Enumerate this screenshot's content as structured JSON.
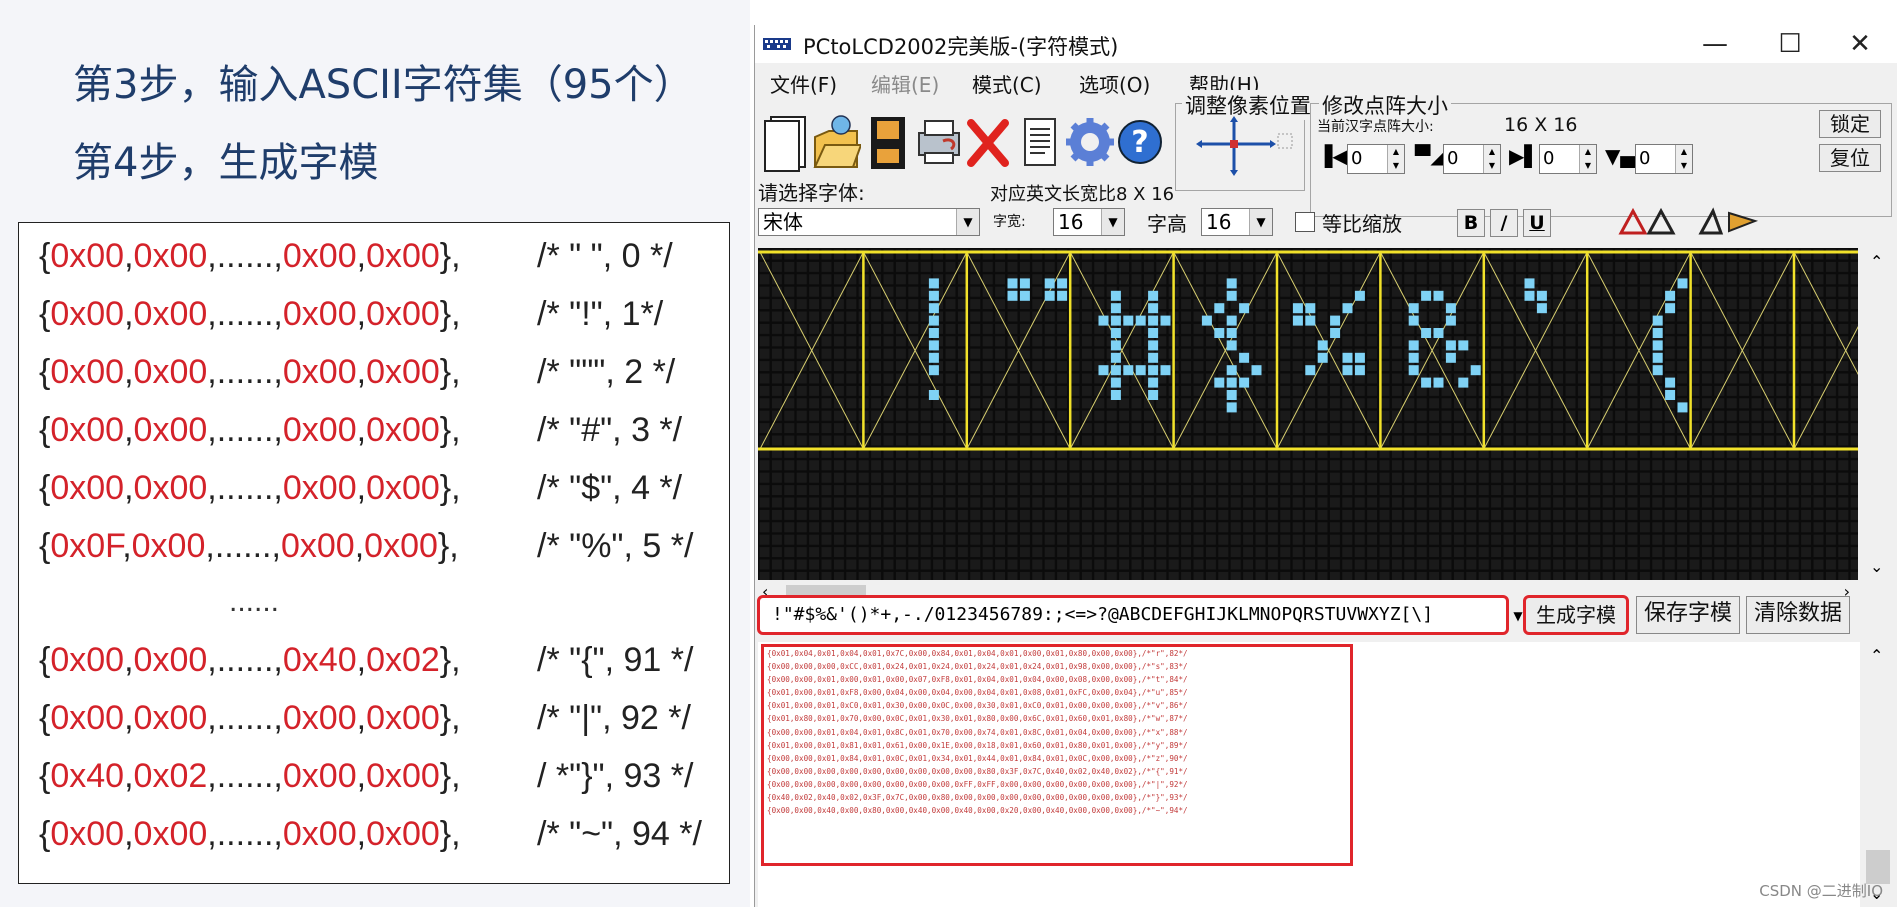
{
  "slide": {
    "step3": "第3步，输入ASCII字符集（95个）",
    "step4": "第4步，生成字模",
    "rows": [
      {
        "a": "0x00",
        "b": "0x00",
        "dots": "......",
        "c": "0x00",
        "d": "0x00",
        "comment": "/* \" \", 0 */"
      },
      {
        "a": "0x00",
        "b": "0x00",
        "dots": "......",
        "c": "0x00",
        "d": "0x00",
        "comment": "/* \"!\", 1*/"
      },
      {
        "a": "0x00",
        "b": "0x00",
        "dots": "......",
        "c": "0x00",
        "d": "0x00",
        "comment": "/* \"\"\", 2 */"
      },
      {
        "a": "0x00",
        "b": "0x00",
        "dots": "......",
        "c": "0x00",
        "d": "0x00",
        "comment": "/* \"#\", 3 */"
      },
      {
        "a": "0x00",
        "b": "0x00",
        "dots": "......",
        "c": "0x00",
        "d": "0x00",
        "comment": "/* \"$\", 4 */"
      },
      {
        "a": "0x0F",
        "b": "0x00",
        "dots": "......",
        "c": "0x00",
        "d": "0x00",
        "comment": "/* \"%\", 5 */"
      },
      {
        "a": "0x00",
        "b": "0x00",
        "dots": "......",
        "c": "0x40",
        "d": "0x02",
        "comment": "/* \"{\", 91 */"
      },
      {
        "a": "0x00",
        "b": "0x00",
        "dots": "......",
        "c": "0x00",
        "d": "0x00",
        "comment": "/* \"|\", 92 */"
      },
      {
        "a": "0x40",
        "b": "0x02",
        "dots": "......",
        "c": "0x00",
        "d": "0x00",
        "comment": "/ *\"}\", 93 */"
      },
      {
        "a": "0x00",
        "b": "0x00",
        "dots": "......",
        "c": "0x00",
        "d": "0x00",
        "comment": "/* \"~\", 94 */"
      }
    ],
    "ellipsis": "......"
  },
  "window": {
    "title": "PCtoLCD2002完美版-(字符模式)",
    "controls": {
      "minimize": "—",
      "maximize": "☐",
      "close": "✕"
    },
    "menu": [
      {
        "label": "文件(F)",
        "disabled": false
      },
      {
        "label": "编辑(E)",
        "disabled": true
      },
      {
        "label": "模式(C)",
        "disabled": false
      },
      {
        "label": "选项(O)",
        "disabled": false
      },
      {
        "label": "帮助(H)",
        "disabled": false
      }
    ],
    "toolbar_icons": [
      "new-file-icon",
      "open-folder-icon",
      "save-disk-icon",
      "printer-icon",
      "delete-x-icon",
      "notepad-icon",
      "settings-gear-icon",
      "help-question-icon"
    ],
    "pixel_adjust": {
      "title": "调整像素位置"
    },
    "matrix_size": {
      "title": "修改点阵大小",
      "current_label": "当前汉字点阵大小:",
      "current_value": "16 X 16",
      "lock_button": "锁定",
      "reset_button": "复位",
      "spinners": [
        "0",
        "0",
        "0",
        "0"
      ]
    },
    "font": {
      "label": "请选择字体:",
      "value": "宋体",
      "ratio_label": "对应英文长宽比",
      "ratio_value": "8 X 16",
      "width_label": "字宽:",
      "width_value": "16",
      "height_label": "字高",
      "height_value": "16",
      "proportional_label": "等比缩放",
      "bold": "B",
      "italic": "/",
      "underline": "U"
    },
    "input_text": "!\"#$%&'()*+,-./0123456789:;<=>?@ABCDEFGHIJKLMNOPQRSTUVWXYZ[\\]",
    "buttons": {
      "generate": "生成字模",
      "save": "保存字模",
      "clear": "清除数据"
    },
    "output_lines": [
      "{0x01,0x04,0x01,0x04,0x01,0x7C,0x00,0x84,0x01,0x04,0x01,0x00,0x01,0x80,0x00,0x00},/*\"r\",82*/",
      "{0x00,0x00,0x00,0xCC,0x01,0x24,0x01,0x24,0x01,0x24,0x01,0x24,0x01,0x98,0x00,0x00},/*\"s\",83*/",
      "{0x00,0x00,0x01,0x00,0x01,0x00,0x07,0xF8,0x01,0x04,0x01,0x04,0x00,0x08,0x00,0x00},/*\"t\",84*/",
      "{0x01,0x00,0x01,0xF8,0x00,0x04,0x00,0x04,0x00,0x04,0x01,0x08,0x01,0xFC,0x00,0x04},/*\"u\",85*/",
      "{0x01,0x00,0x01,0xC0,0x01,0x30,0x00,0x0C,0x00,0x30,0x01,0xC0,0x01,0x00,0x00,0x00},/*\"v\",86*/",
      "{0x01,0x80,0x01,0x70,0x00,0x0C,0x01,0x30,0x01,0x80,0x00,0x6C,0x01,0x60,0x01,0x80},/*\"w\",87*/",
      "{0x00,0x00,0x01,0x04,0x01,0x8C,0x01,0x70,0x00,0x74,0x01,0x8C,0x01,0x04,0x00,0x00},/*\"x\",88*/",
      "{0x01,0x00,0x01,0x81,0x01,0x61,0x00,0x1E,0x00,0x18,0x01,0x60,0x01,0x80,0x01,0x00},/*\"y\",89*/",
      "{0x00,0x00,0x01,0x84,0x01,0x0C,0x01,0x34,0x01,0x44,0x01,0x84,0x01,0x0C,0x00,0x00},/*\"z\",90*/",
      "{0x00,0x00,0x00,0x00,0x00,0x00,0x00,0x00,0x00,0x80,0x3F,0x7C,0x40,0x02,0x40,0x02},/*\"{\",91*/",
      "{0x00,0x00,0x00,0x00,0x00,0x00,0x00,0x00,0xFF,0xFF,0x00,0x00,0x00,0x00,0x00,0x00},/*\"|\",92*/",
      "{0x40,0x02,0x40,0x02,0x3F,0x7C,0x00,0x80,0x00,0x00,0x00,0x00,0x00,0x00,0x00,0x00},/*\"}\",93*/",
      "{0x00,0x00,0x40,0x00,0x80,0x00,0x40,0x00,0x40,0x00,0x20,0x00,0x40,0x00,0x00,0x00},/*\"~\",94*/"
    ],
    "watermark": "CSDN @二进制IO"
  },
  "colors": {
    "hex_value": "#d4222a",
    "highlight_border": "#e0252b",
    "pixel_on": "#7fd2f5",
    "grid_frame": "#f2e22a",
    "title_blue": "#1f3d6b"
  }
}
